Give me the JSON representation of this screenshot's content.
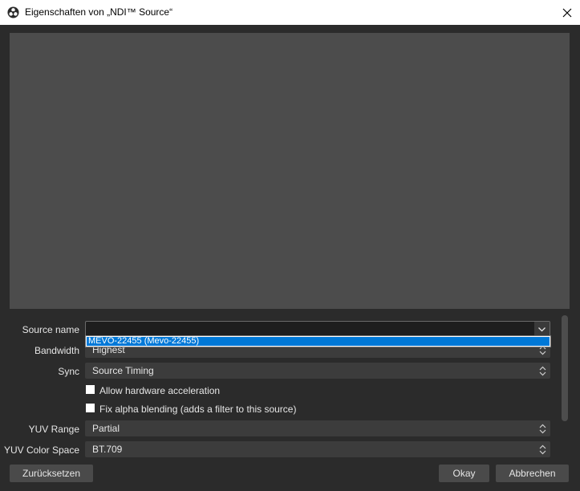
{
  "window": {
    "title": "Eigenschaften von „NDI™ Source“",
    "app_icon": "obs-logo-icon",
    "close_icon": "close-icon"
  },
  "properties": {
    "source_name": {
      "label": "Source name",
      "value": "",
      "options": [
        "MEVO-22455 (Mevo-22455)"
      ],
      "highlighted": "MEVO-22455 (Mevo-22455)"
    },
    "bandwidth": {
      "label": "Bandwidth",
      "value": "Highest"
    },
    "sync": {
      "label": "Sync",
      "value": "Source Timing"
    },
    "hw_accel": {
      "label": "Allow hardware acceleration",
      "checked": false
    },
    "fix_alpha": {
      "label": "Fix alpha blending (adds a filter to this source)",
      "checked": false
    },
    "yuv_range": {
      "label": "YUV Range",
      "value": "Partial"
    },
    "yuv_color_space": {
      "label": "YUV Color Space",
      "value": "BT.709"
    }
  },
  "buttons": {
    "reset": "Zurücksetzen",
    "ok": "Okay",
    "cancel": "Abbrechen"
  },
  "colors": {
    "accent": "#0078d7",
    "background": "#2b2b2b",
    "preview": "#4c4c4c"
  }
}
